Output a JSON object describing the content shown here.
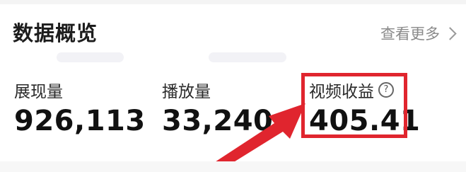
{
  "header": {
    "title": "数据概览",
    "more_label": "查看更多"
  },
  "metrics": [
    {
      "label": "展现量",
      "value": "926,113"
    },
    {
      "label": "播放量",
      "value": "33,240"
    },
    {
      "label": "视频收益",
      "value": "405.41"
    }
  ],
  "icons": {
    "help": "question-circle-icon",
    "more": "chevron-right-icon"
  },
  "colors": {
    "annotation_red": "#e0252e",
    "muted_text": "#8a8a8a"
  }
}
